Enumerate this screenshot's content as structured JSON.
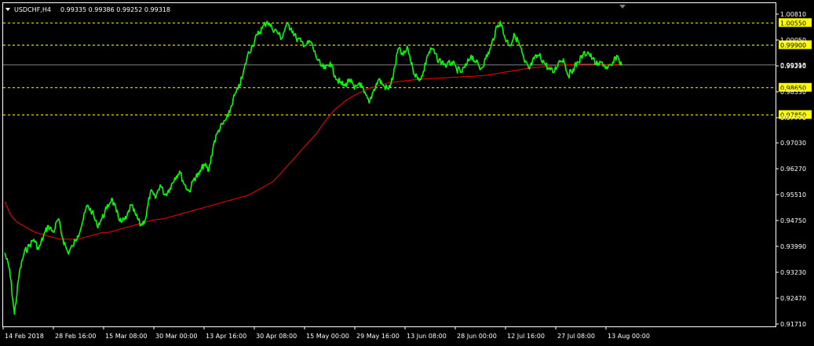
{
  "header": {
    "symbol_timeframe": "USDCHF,H4",
    "ohlc": "0.99335 0.99386 0.99252 0.99318"
  },
  "colors": {
    "background": "#000000",
    "frame": "#ffffff",
    "price_line": "#00ff00",
    "moving_average": "#ff0000",
    "level_lines": "#ffff00",
    "badge_fill": "#ffff00",
    "current_price_line": "#808080"
  },
  "icons": {
    "dropdown": "triangle-down-icon",
    "marker": "triangle-down-icon"
  },
  "chart_data": {
    "type": "line",
    "ylim": [
      0.9171,
      1.0081
    ],
    "grid": false,
    "x_tick_labels": [
      "14 Feb 2018",
      "28 Feb 16:00",
      "15 Mar 08:00",
      "30 Mar 00:00",
      "13 Apr 16:00",
      "30 Apr 08:00",
      "15 May 00:00",
      "29 May 16:00",
      "13 Jun 08:00",
      "28 Jun 00:00",
      "12 Jul 16:00",
      "27 Jul 08:00",
      "13 Aug 00:00"
    ],
    "y_ticks": [
      {
        "value": 1.0081,
        "label": "1.00810"
      },
      {
        "value": 1.0005,
        "label": "1.00050"
      },
      {
        "value": 0.9929,
        "label": "0.99290"
      },
      {
        "value": 0.9853,
        "label": "0.98530"
      },
      {
        "value": 0.9777,
        "label": "0.97770"
      },
      {
        "value": 0.9703,
        "label": "0.97030"
      },
      {
        "value": 0.9627,
        "label": "0.96270"
      },
      {
        "value": 0.9551,
        "label": "0.95510"
      },
      {
        "value": 0.9475,
        "label": "0.94750"
      },
      {
        "value": 0.9399,
        "label": "0.93990"
      },
      {
        "value": 0.9323,
        "label": "0.93230"
      },
      {
        "value": 0.9247,
        "label": "0.92470"
      },
      {
        "value": 0.9171,
        "label": "0.91710"
      }
    ],
    "levels": [
      {
        "value": 1.0055,
        "label": "1.00550"
      },
      {
        "value": 0.999,
        "label": "0.99900"
      },
      {
        "value": 0.9865,
        "label": "0.98650"
      },
      {
        "value": 0.9785,
        "label": "0.97850"
      }
    ],
    "current_price": {
      "value": 0.99318,
      "label": "0.99318"
    },
    "series": [
      {
        "values": [
          0.938,
          0.933,
          0.92,
          0.932,
          0.938,
          0.94,
          0.942,
          0.939,
          0.943,
          0.946,
          0.944,
          0.948,
          0.942,
          0.938,
          0.94,
          0.943,
          0.947,
          0.952,
          0.95,
          0.946,
          0.948,
          0.951,
          0.954,
          0.95,
          0.947,
          0.948,
          0.952,
          0.949,
          0.946,
          0.948,
          0.956,
          0.954,
          0.958,
          0.955,
          0.957,
          0.96,
          0.962,
          0.958,
          0.956,
          0.96,
          0.961,
          0.964,
          0.962,
          0.97,
          0.974,
          0.976,
          0.978,
          0.983,
          0.986,
          0.99,
          0.996,
          0.999,
          1.002,
          1.004,
          1.006,
          1.004,
          1.003,
          1.001,
          1.005,
          1.004,
          1.001,
          1.0,
          0.999,
          1.0,
          0.996,
          0.993,
          0.992,
          0.994,
          0.99,
          0.988,
          0.987,
          0.989,
          0.986,
          0.988,
          0.985,
          0.982,
          0.986,
          0.989,
          0.987,
          0.986,
          0.99,
          0.998,
          0.996,
          0.998,
          0.992,
          0.989,
          0.99,
          0.996,
          0.998,
          0.995,
          0.994,
          0.993,
          0.994,
          0.992,
          0.991,
          0.993,
          0.996,
          0.994,
          0.992,
          0.995,
          0.998,
          1.003,
          1.006,
          1.001,
          0.999,
          1.002,
          0.999,
          0.994,
          0.992,
          0.995,
          0.996,
          0.994,
          0.992,
          0.991,
          0.994,
          0.995,
          0.99,
          0.992,
          0.994,
          0.996,
          0.997,
          0.995,
          0.993,
          0.994,
          0.992,
          0.993,
          0.996,
          0.993
        ]
      },
      {
        "values": [
          0.953,
          0.949,
          0.947,
          0.946,
          0.945,
          0.944,
          0.9435,
          0.943,
          0.9425,
          0.942,
          0.942,
          0.942,
          0.942,
          0.9425,
          0.943,
          0.9435,
          0.944,
          0.944,
          0.9445,
          0.945,
          0.9455,
          0.946,
          0.9465,
          0.947,
          0.9475,
          0.9478,
          0.948,
          0.9485,
          0.949,
          0.9495,
          0.95,
          0.9505,
          0.951,
          0.9515,
          0.952,
          0.9525,
          0.953,
          0.9535,
          0.954,
          0.9545,
          0.955,
          0.956,
          0.957,
          0.958,
          0.959,
          0.961,
          0.963,
          0.965,
          0.967,
          0.969,
          0.971,
          0.973,
          0.9755,
          0.978,
          0.98,
          0.9815,
          0.983,
          0.984,
          0.985,
          0.9858,
          0.9865,
          0.987,
          0.9875,
          0.988,
          0.9882,
          0.9884,
          0.9886,
          0.9888,
          0.989,
          0.9891,
          0.9892,
          0.9893,
          0.9894,
          0.9895,
          0.9896,
          0.9897,
          0.9898,
          0.9899,
          0.99,
          0.9902,
          0.9905,
          0.9908,
          0.9911,
          0.9914,
          0.9917,
          0.992,
          0.9922,
          0.9924,
          0.9926,
          0.9928,
          0.993,
          0.9931,
          0.9932,
          0.9933,
          0.9934,
          0.9934,
          0.9934,
          0.9934,
          0.9933,
          0.9933,
          0.9933,
          0.9933
        ]
      }
    ]
  }
}
